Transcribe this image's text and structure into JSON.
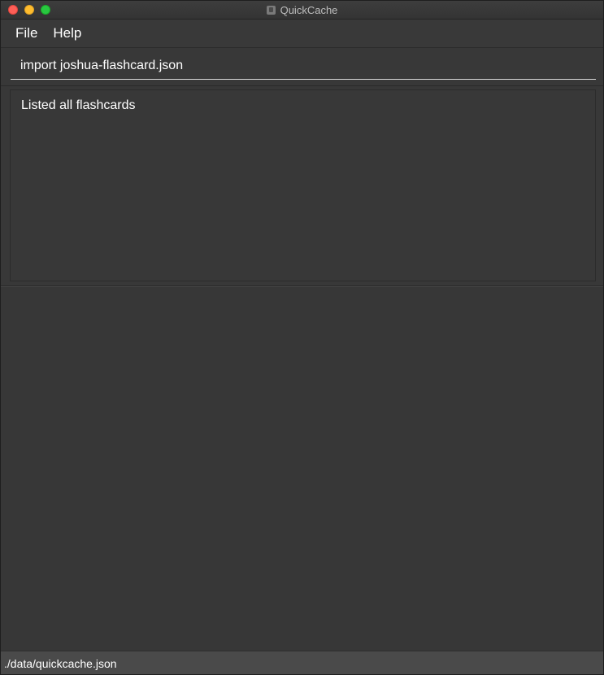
{
  "window": {
    "title": "QuickCache",
    "title_icon": "app-icon",
    "controls": {
      "close_color": "#fe5f57",
      "minimize_color": "#febc2e",
      "maximize_color": "#28c840"
    }
  },
  "menu": {
    "items": [
      {
        "label": "File"
      },
      {
        "label": "Help"
      }
    ]
  },
  "command": {
    "value": "import joshua-flashcard.json"
  },
  "result": {
    "message": "Listed all flashcards"
  },
  "flashcard_list": {
    "items": []
  },
  "status": {
    "file_path": "./data/quickcache.json"
  }
}
